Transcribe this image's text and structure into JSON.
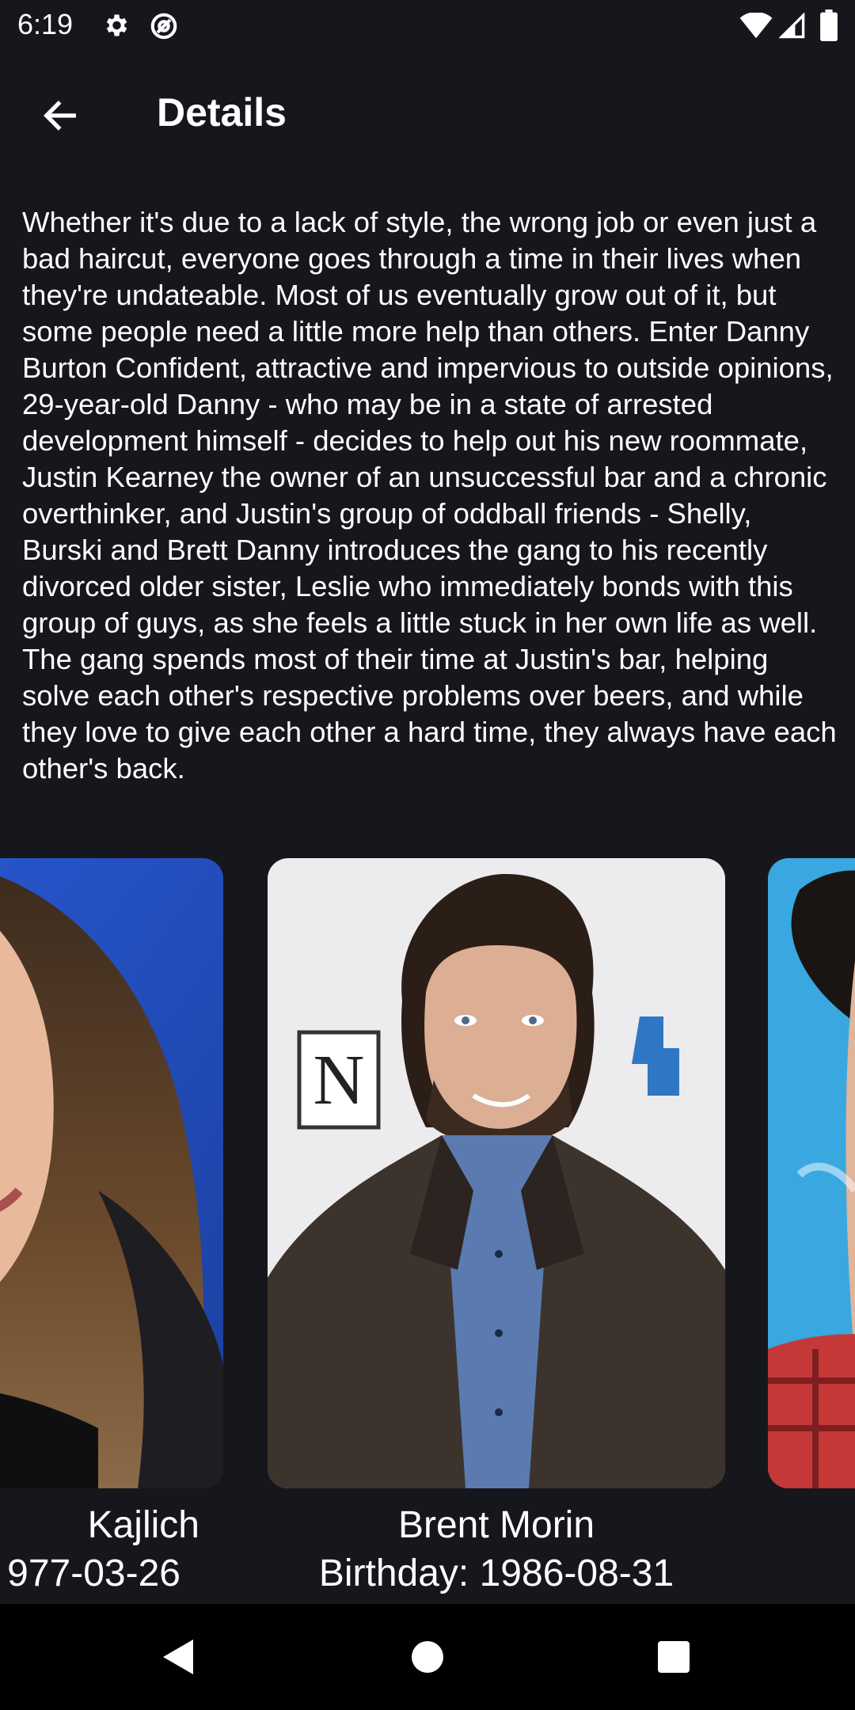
{
  "status_bar": {
    "time": "6:19",
    "icons": [
      "settings-icon",
      "at-sign-icon",
      "wifi-icon",
      "signal-icon",
      "battery-icon"
    ]
  },
  "app_bar": {
    "title": "Details",
    "back_icon": "arrow-left-icon"
  },
  "description": "Whether it's due to a lack of style, the wrong job or even just a bad haircut, everyone goes through a time in their lives when they're undateable. Most of us eventually grow out of it, but some people need a little more help than others. Enter Danny Burton Confident, attractive and impervious to outside opinions, 29-year-old Danny - who may be in a state of arrested development himself - decides to help out his new roommate, Justin Kearney the owner of an unsuccessful bar and a chronic overthinker, and Justin's group of oddball friends - Shelly, Burski and Brett Danny introduces the gang to his recently divorced older sister, Leslie who immediately bonds with this group of guys, as she feels a little stuck in her own life as well. The gang spends most of their time at Justin's bar, helping solve each other's respective problems over beers, and while they love to give each other a hard time, they always have each other's back.",
  "cast": [
    {
      "name": "Kajlich",
      "birthday": "977-03-26"
    },
    {
      "name": "Brent Morin",
      "birthday": "Birthday: 1986-08-31"
    },
    {
      "name": "",
      "birthday": ""
    }
  ],
  "nav_bar": {
    "back_icon": "triangle-back-icon",
    "home_icon": "circle-home-icon",
    "recents_icon": "square-recents-icon"
  },
  "colors": {
    "background": "#16171d",
    "text": "#ffffff",
    "nav_background": "#000000"
  }
}
